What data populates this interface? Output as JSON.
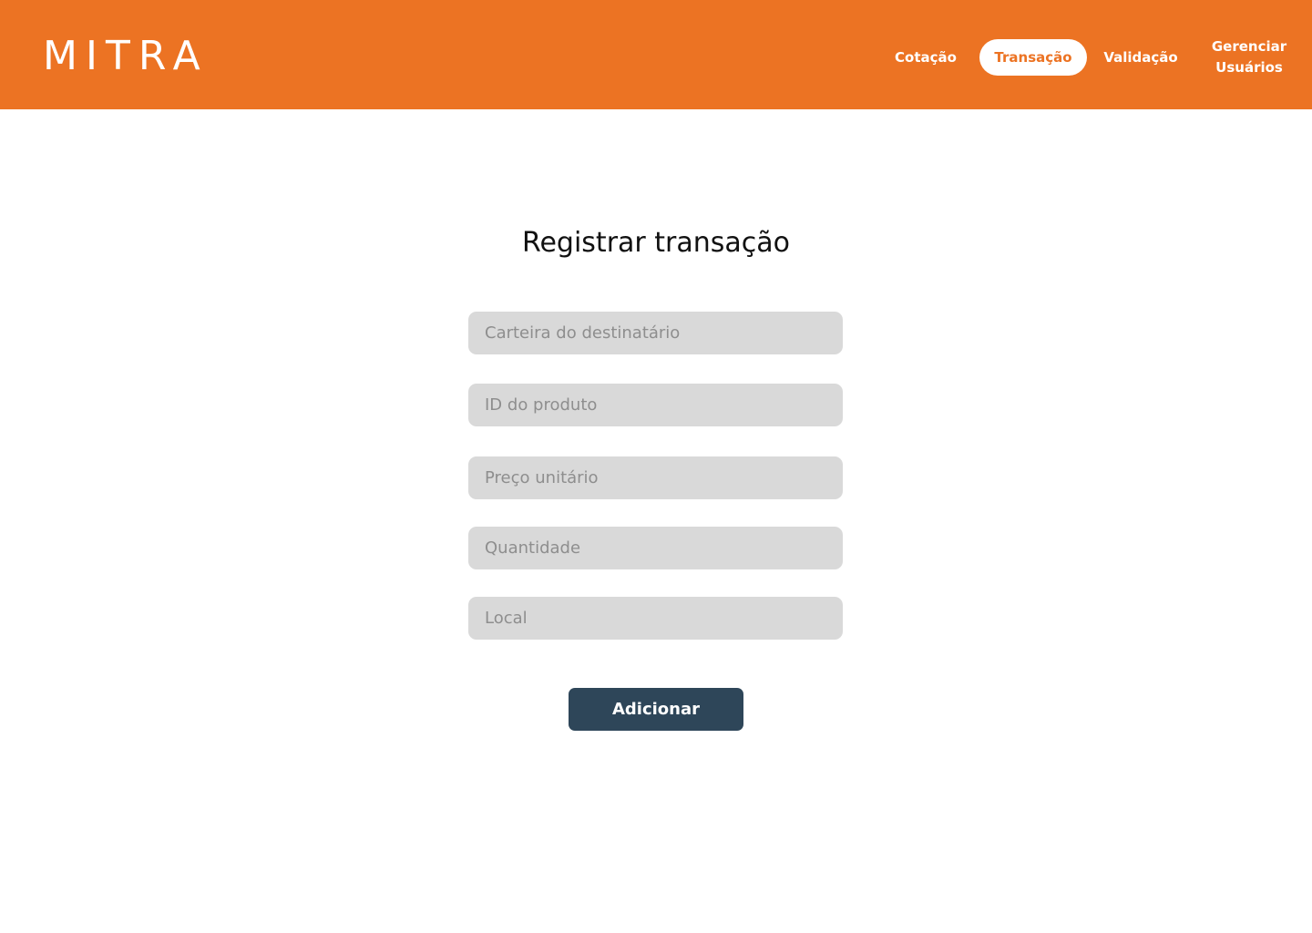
{
  "header": {
    "logo_text": "MITRA",
    "background_color": "#EC7323",
    "nav": {
      "cotacao": "Cotação",
      "transacao": "Transação",
      "validacao": "Validação",
      "gerenciar_line1": "Gerenciar",
      "gerenciar_line2": "Usuários"
    },
    "active_tab": "Transação"
  },
  "main": {
    "title": "Registrar transação",
    "fields": {
      "carteira": {
        "placeholder": "Carteira do destinatário",
        "value": ""
      },
      "id_produto": {
        "placeholder": "ID do produto",
        "value": ""
      },
      "preco": {
        "placeholder": "Preço unitário",
        "value": ""
      },
      "quantidade": {
        "placeholder": "Quantidade",
        "value": ""
      },
      "local": {
        "placeholder": "Local",
        "value": ""
      }
    },
    "submit_label": "Adicionar",
    "submit_color": "#2E4659"
  }
}
